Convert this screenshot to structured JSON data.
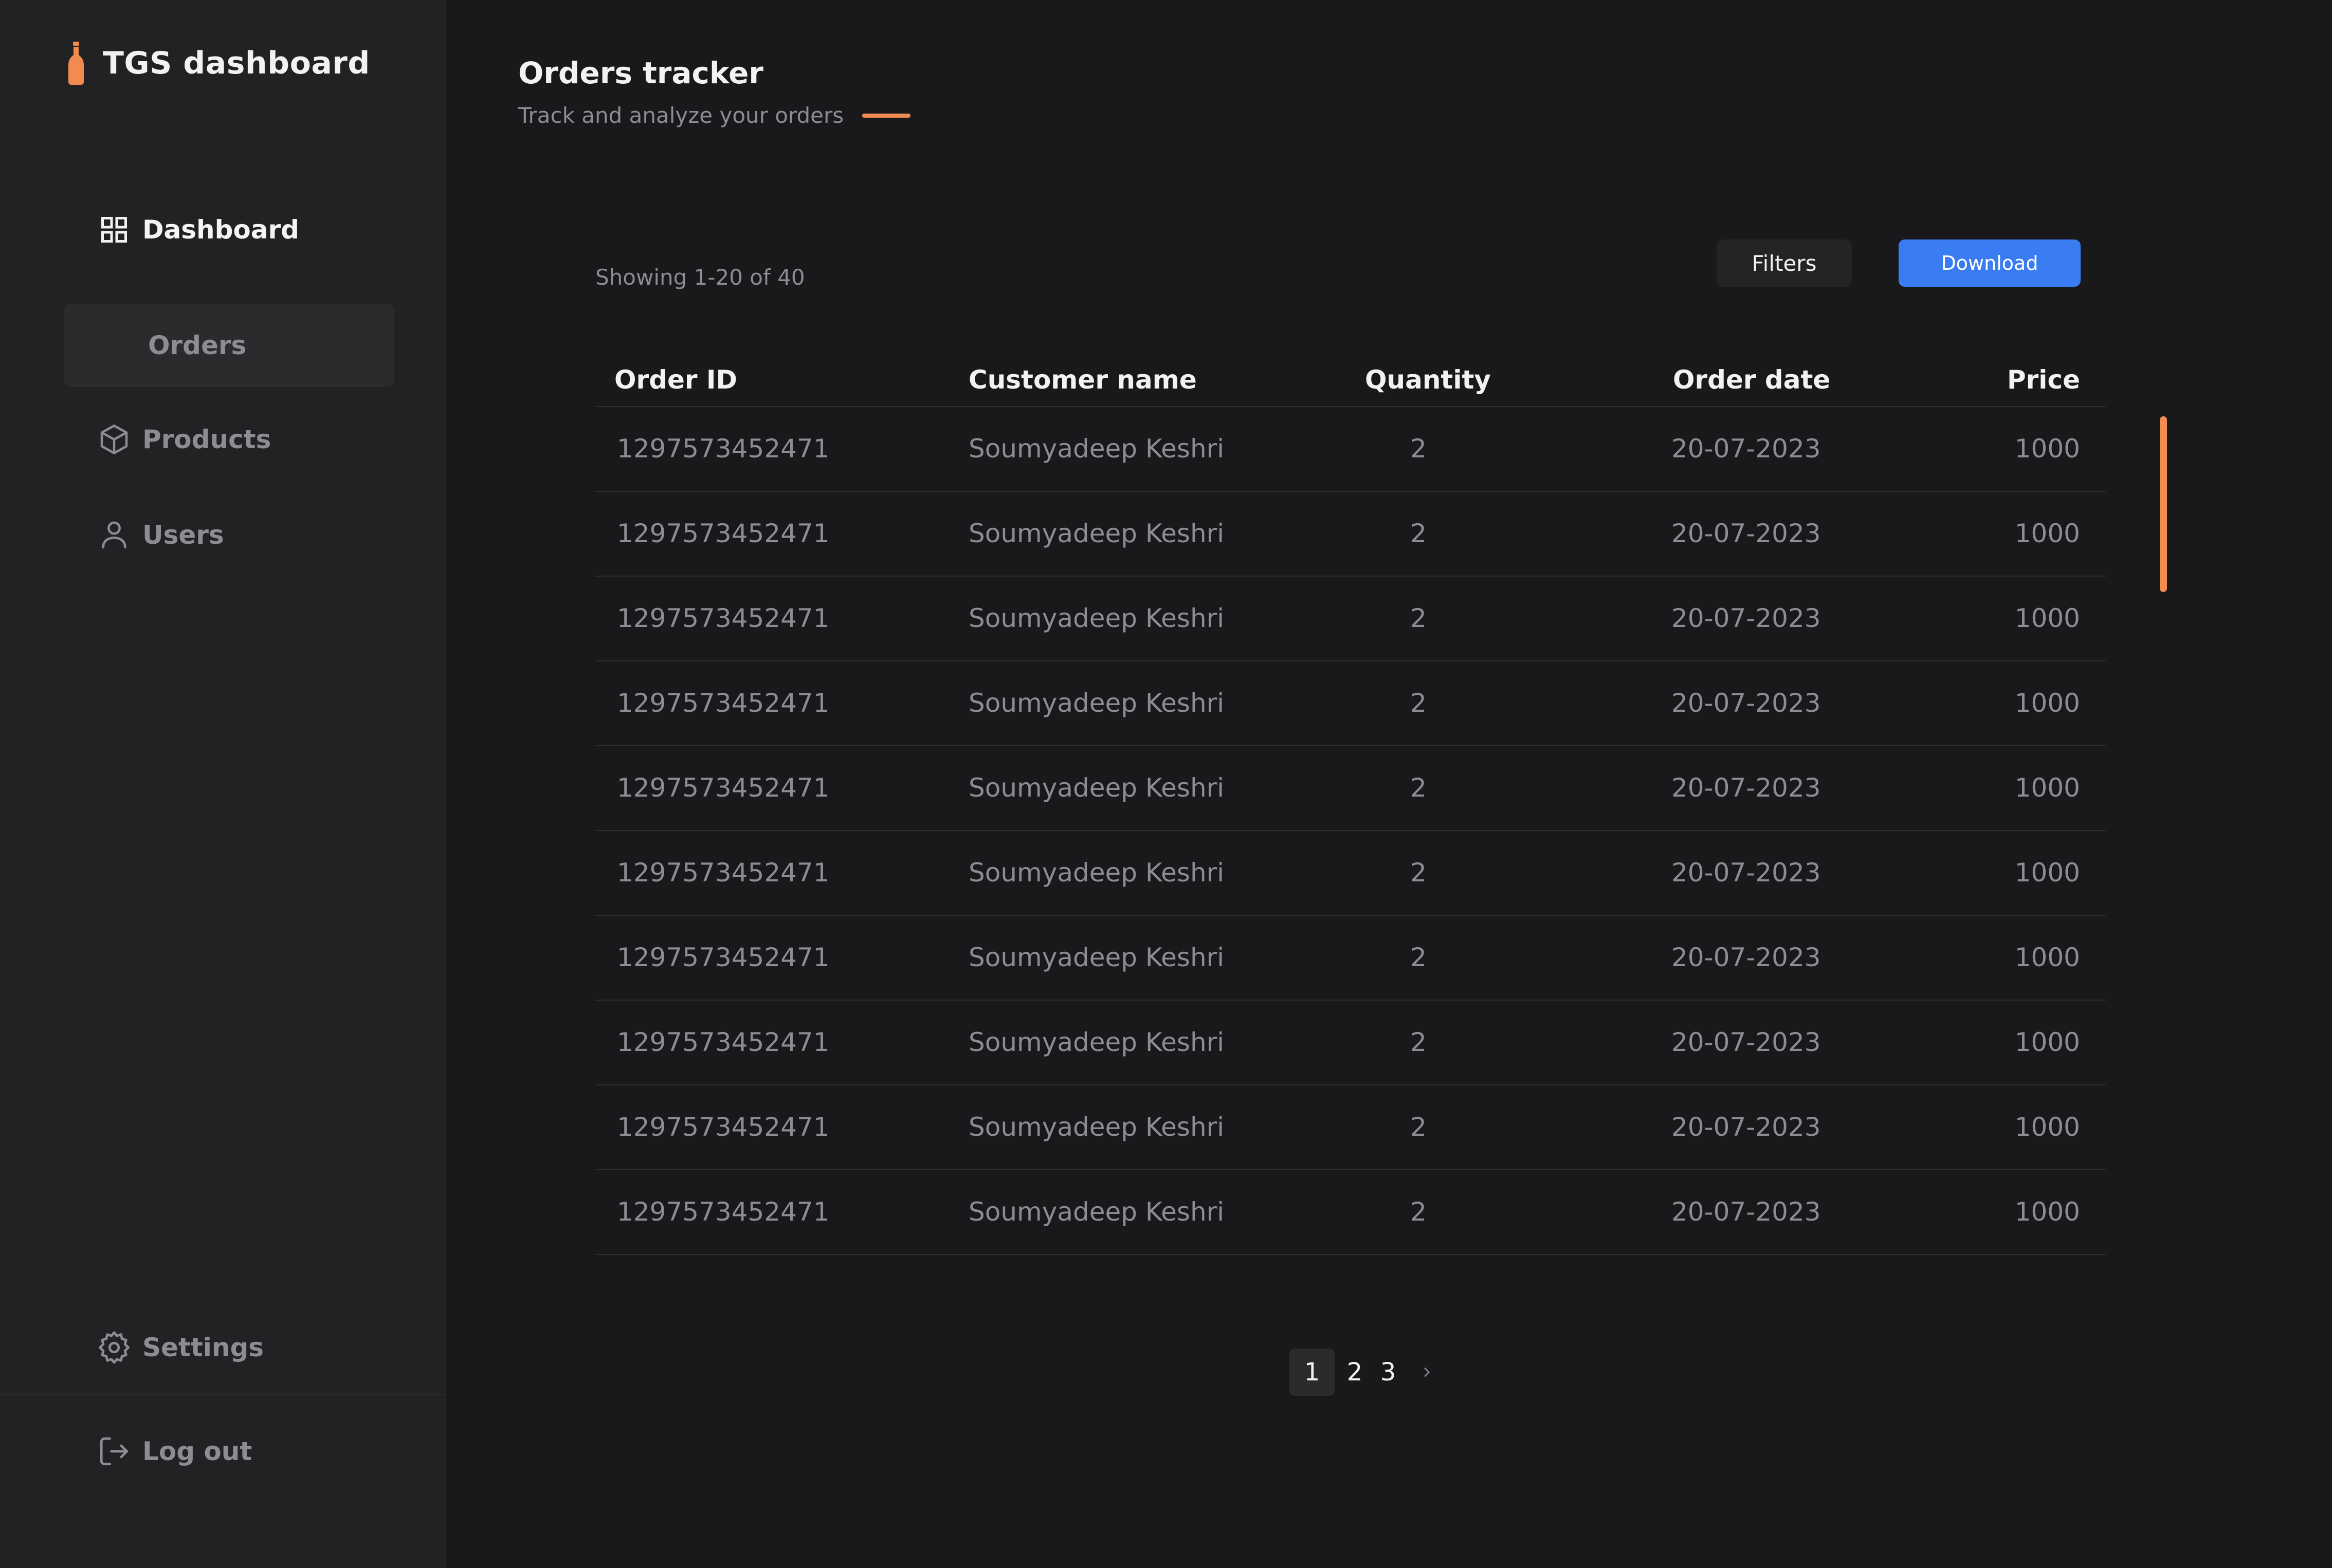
{
  "app": {
    "title": "TGS dashboard",
    "accent_color": "#f28b50",
    "primary_button_color": "#3a7cf2"
  },
  "sidebar": {
    "items": [
      {
        "label": "Dashboard",
        "icon": "grid-icon",
        "active": true
      },
      {
        "label": "Orders",
        "icon": "",
        "selected": true
      },
      {
        "label": "Products",
        "icon": "box-icon"
      },
      {
        "label": "Users",
        "icon": "user-icon"
      }
    ],
    "footer": [
      {
        "label": "Settings",
        "icon": "gear-icon"
      },
      {
        "label": "Log out",
        "icon": "logout-icon"
      }
    ]
  },
  "header": {
    "title": "Orders tracker",
    "subtitle": "Track and analyze your orders"
  },
  "toolbar": {
    "showing": "Showing 1-20 of 40",
    "filters_label": "Filters",
    "download_label": "Download"
  },
  "table": {
    "columns": [
      "Order ID",
      "Customer name",
      "Quantity",
      "Order date",
      "Price"
    ],
    "rows": [
      [
        "1297573452471",
        "Soumyadeep Keshri",
        "2",
        "20-07-2023",
        "1000"
      ],
      [
        "1297573452471",
        "Soumyadeep Keshri",
        "2",
        "20-07-2023",
        "1000"
      ],
      [
        "1297573452471",
        "Soumyadeep Keshri",
        "2",
        "20-07-2023",
        "1000"
      ],
      [
        "1297573452471",
        "Soumyadeep Keshri",
        "2",
        "20-07-2023",
        "1000"
      ],
      [
        "1297573452471",
        "Soumyadeep Keshri",
        "2",
        "20-07-2023",
        "1000"
      ],
      [
        "1297573452471",
        "Soumyadeep Keshri",
        "2",
        "20-07-2023",
        "1000"
      ],
      [
        "1297573452471",
        "Soumyadeep Keshri",
        "2",
        "20-07-2023",
        "1000"
      ],
      [
        "1297573452471",
        "Soumyadeep Keshri",
        "2",
        "20-07-2023",
        "1000"
      ],
      [
        "1297573452471",
        "Soumyadeep Keshri",
        "2",
        "20-07-2023",
        "1000"
      ],
      [
        "1297573452471",
        "Soumyadeep Keshri",
        "2",
        "20-07-2023",
        "1000"
      ]
    ]
  },
  "pagination": {
    "pages": [
      "1",
      "2",
      "3"
    ],
    "current": "1",
    "next_icon": "chevron-right-icon"
  }
}
